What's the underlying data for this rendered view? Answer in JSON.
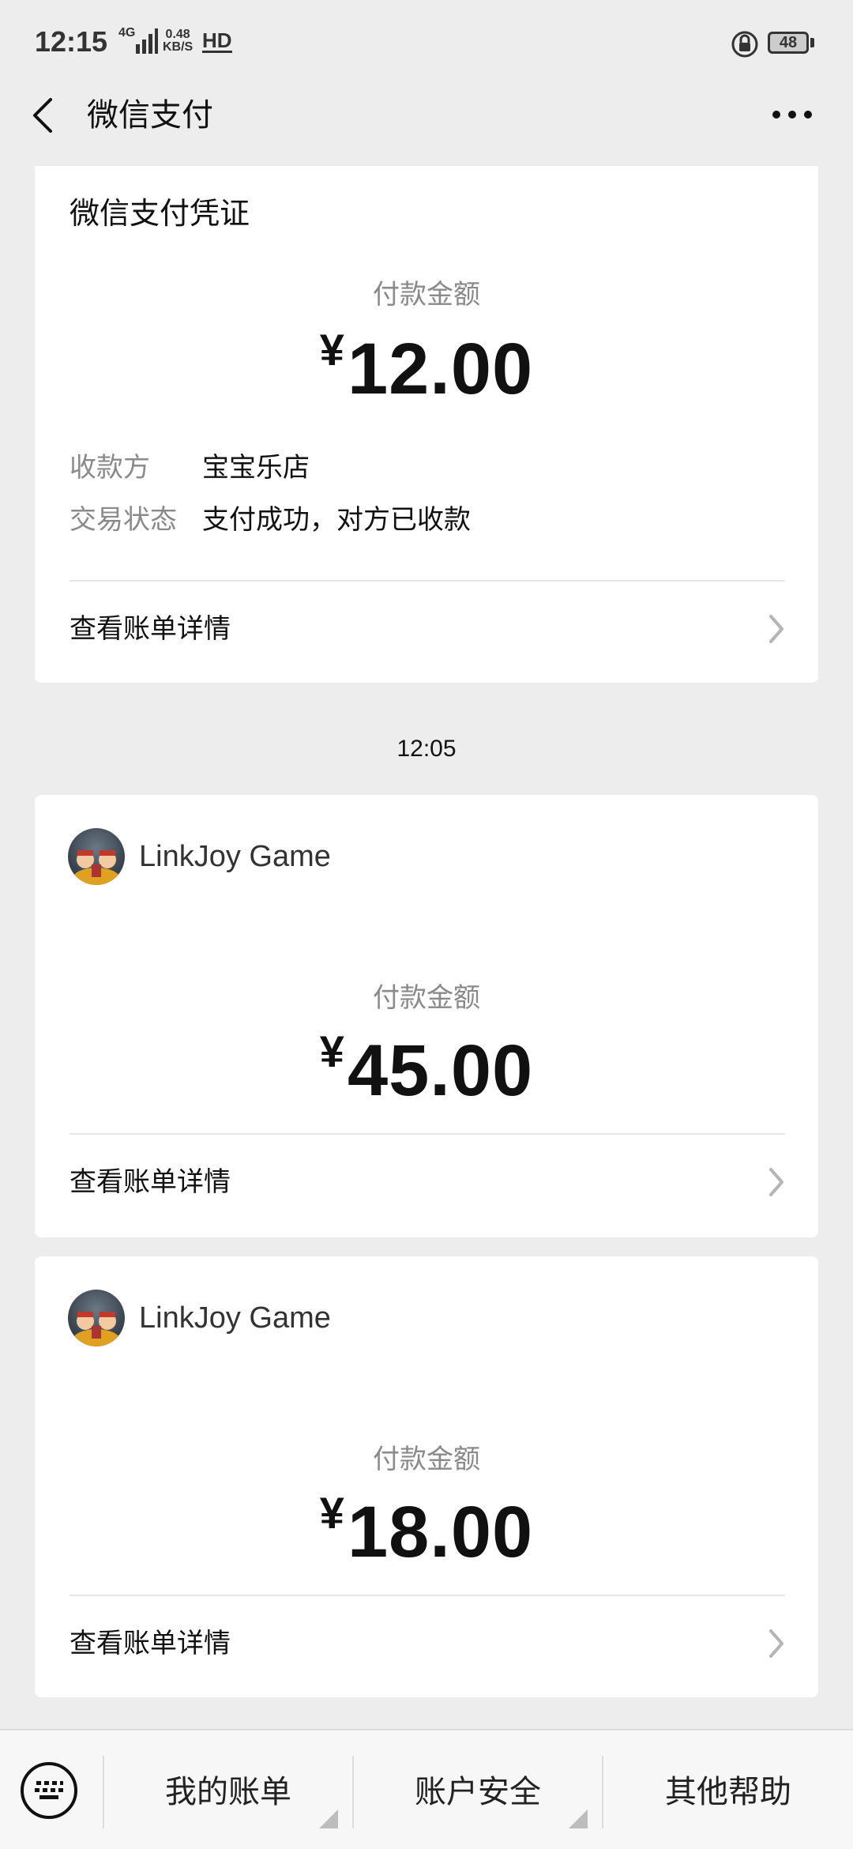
{
  "status_bar": {
    "time": "12:15",
    "network": "4G",
    "speed_value": "0.48",
    "speed_unit": "KB/S",
    "hd": "HD",
    "battery": "48"
  },
  "nav": {
    "title": "微信支付"
  },
  "cards": [
    {
      "title": "微信支付凭证",
      "amount_label": "付款金额",
      "currency": "¥",
      "amount": "12.00",
      "rows": [
        {
          "label": "收款方",
          "value": "宝宝乐店"
        },
        {
          "label": "交易状态",
          "value": "支付成功，对方已收款"
        }
      ],
      "detail_link": "查看账单详情"
    },
    {
      "merchant": "LinkJoy Game",
      "amount_label": "付款金额",
      "currency": "¥",
      "amount": "45.00",
      "detail_link": "查看账单详情"
    },
    {
      "merchant": "LinkJoy Game",
      "amount_label": "付款金额",
      "currency": "¥",
      "amount": "18.00",
      "detail_link": "查看账单详情"
    }
  ],
  "timestamp": "12:05",
  "bottom_menu": {
    "items": [
      "我的账单",
      "账户安全",
      "其他帮助"
    ]
  }
}
